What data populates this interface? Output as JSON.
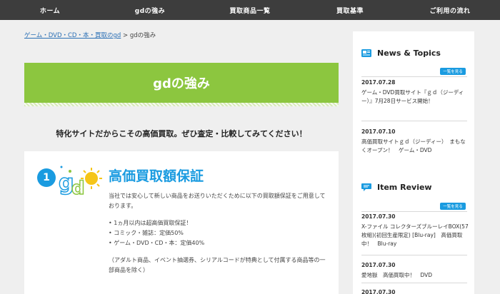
{
  "nav": {
    "items": [
      "ホーム",
      "gdの強み",
      "買取商品一覧",
      "買取基準",
      "ご利用の流れ"
    ]
  },
  "breadcrumb": {
    "link": "ゲーム・DVD・CD・本・買取のgd",
    "separator": ">",
    "current": "gdの強み"
  },
  "page": {
    "title": "gdの強み",
    "tagline": "特化サイトだからこその高価買取。ぜひ査定・比較してみてください！"
  },
  "card": {
    "number": "1",
    "title": "高価買取額保証",
    "intro": "当社では安心して新しい商品をお送りいただくために以下の買取額保証をご用意しております。",
    "bullets": [
      "1ヵ月以内は超高価買取保証！",
      "コミック・雑誌：定価50%",
      "ゲーム・DVD・CD・本：定価40%"
    ],
    "note": "（アダルト商品、イベント抽選券、シリアルコードが特典として付属する商品等の一部商品を除く）"
  },
  "sidebar": {
    "news": {
      "title": "News & Topics",
      "more": "一覧を見る",
      "items": [
        {
          "date": "2017.07.28",
          "text": "ゲーム・DVD買取サイト『ｇｄ（ジーディー）』7月28日サービス開始！"
        },
        {
          "date": "2017.07.10",
          "text": "高価買取サイトｇｄ（ジーディー）　まもなくオープン！　ゲーム・DVD"
        }
      ]
    },
    "review": {
      "title": "Item Review",
      "more": "一覧を見る",
      "items": [
        {
          "date": "2017.07.30",
          "text": "X-ファイル コレクターズブルーレイBOX(57枚組)(初回生産限定) [Blu-ray]　高価買取中！　Blu-ray"
        },
        {
          "date": "2017.07.30",
          "text": "愛地獄　高価買取中！　DVD"
        },
        {
          "date": "2017.07.30",
          "text": ""
        }
      ]
    }
  },
  "colors": {
    "nav_bg": "#3d3d3d",
    "accent_green": "#8cc63f",
    "accent_blue": "#1a9be0",
    "link": "#2a6fb5"
  }
}
